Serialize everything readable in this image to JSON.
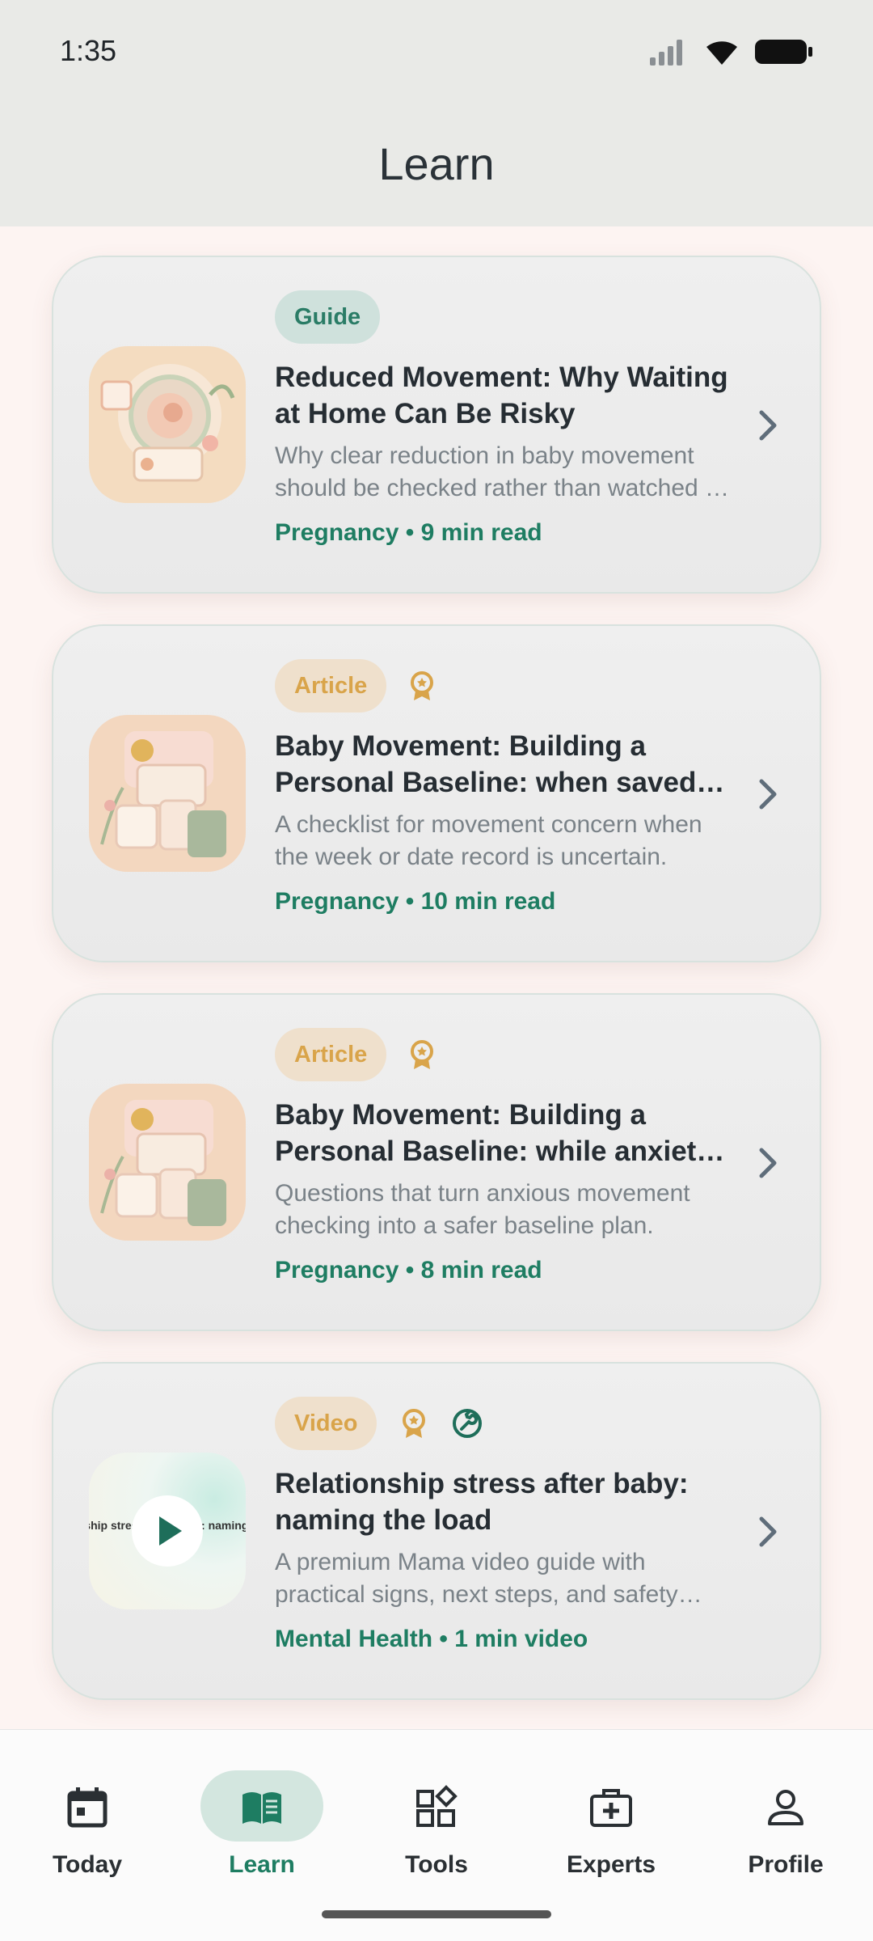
{
  "status_bar": {
    "time": "1:35"
  },
  "header": {
    "title": "Learn"
  },
  "cards": [
    {
      "badge": "Guide",
      "title": "Reduced Movement: Why Waiting at Home Can Be Risky",
      "description": "Why clear reduction in baby movement should be checked rather than watched at home.",
      "meta": "Pregnancy • 9 min read",
      "extra_icons": []
    },
    {
      "badge": "Article",
      "title": "Baby Movement: Building a Personal Baseline: when saved dates are unclear",
      "description": "A checklist for movement concern when the week or date record is uncertain.",
      "meta": "Pregnancy • 10 min read",
      "extra_icons": [
        "award-icon"
      ]
    },
    {
      "badge": "Article",
      "title": "Baby Movement: Building a Personal Baseline: while anxiety is high",
      "description": "Questions that turn anxious movement checking into a safer baseline plan.",
      "meta": "Pregnancy • 8 min read",
      "extra_icons": [
        "award-icon"
      ]
    },
    {
      "badge": "Video",
      "title": "Relationship stress after baby: naming the load",
      "description": "A premium Mama video guide with practical signs, next steps, and safety notes.",
      "meta": "Mental Health • 1 min video",
      "thumbnail_text": "Relationship stress after baby: naming the load",
      "extra_icons": [
        "award-icon",
        "wrench-icon"
      ]
    }
  ],
  "bottom_nav": [
    {
      "label": "Today",
      "icon": "calendar-icon",
      "active": false
    },
    {
      "label": "Learn",
      "icon": "book-icon",
      "active": true
    },
    {
      "label": "Tools",
      "icon": "widgets-icon",
      "active": false
    },
    {
      "label": "Experts",
      "icon": "medical-kit-icon",
      "active": false
    },
    {
      "label": "Profile",
      "icon": "person-icon",
      "active": false
    }
  ],
  "colors": {
    "accent": "#1e7d62",
    "badge_gold": "#d9a44a",
    "header_bg": "#e9eae7",
    "page_bg": "#fdf4f2"
  }
}
